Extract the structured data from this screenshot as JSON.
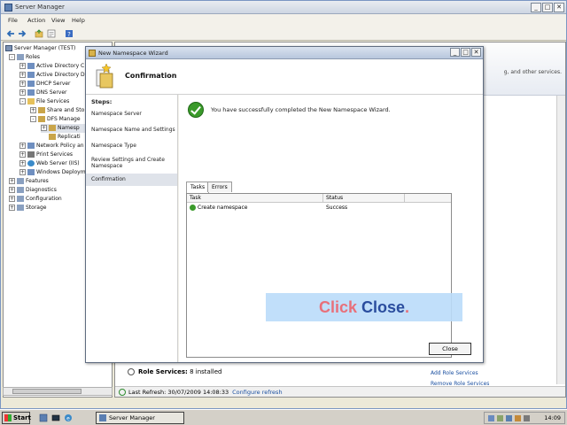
{
  "server_manager": {
    "title": "Server Manager",
    "menu": [
      "File",
      "Action",
      "View",
      "Help"
    ],
    "tree": [
      {
        "label": "Server Manager (TEST)",
        "expander": "",
        "indent": 0
      },
      {
        "label": "Roles",
        "expander": "-",
        "indent": 1
      },
      {
        "label": "Active Directory C",
        "expander": "+",
        "indent": 2
      },
      {
        "label": "Active Directory D",
        "expander": "+",
        "indent": 2
      },
      {
        "label": "DHCP Server",
        "expander": "+",
        "indent": 2
      },
      {
        "label": "DNS Server",
        "expander": "+",
        "indent": 2
      },
      {
        "label": "File Services",
        "expander": "-",
        "indent": 2
      },
      {
        "label": "Share and Sto",
        "expander": "+",
        "indent": 3
      },
      {
        "label": "DFS Manage",
        "expander": "-",
        "indent": 3
      },
      {
        "label": "Namesp",
        "expander": "+",
        "indent": 4
      },
      {
        "label": "Replicati",
        "expander": "",
        "indent": 4
      },
      {
        "label": "Network Policy an",
        "expander": "+",
        "indent": 2
      },
      {
        "label": "Print Services",
        "expander": "+",
        "indent": 2
      },
      {
        "label": "Web Server (IIS)",
        "expander": "+",
        "indent": 2
      },
      {
        "label": "Windows Deploym",
        "expander": "+",
        "indent": 2
      },
      {
        "label": "Features",
        "expander": "+",
        "indent": 1
      },
      {
        "label": "Diagnostics",
        "expander": "+",
        "indent": 1
      },
      {
        "label": "Configuration",
        "expander": "+",
        "indent": 1
      },
      {
        "label": "Storage",
        "expander": "+",
        "indent": 1
      }
    ],
    "header_hint": "g, and other services.",
    "role_services_label": "Role Services:",
    "role_services_count": "8 installed",
    "add_role_services": "Add Role Services",
    "remove_role_services": "Remove Role Services",
    "status_text": "Last Refresh: 30/07/2009 14:08:33",
    "configure_refresh": "Configure refresh"
  },
  "wizard": {
    "title": "New Namespace Wizard",
    "page_title": "Confirmation",
    "steps_title": "Steps:",
    "steps": [
      "Namespace Server",
      "Namespace Name and Settings",
      "Namespace Type",
      "Review Settings and Create Namespace",
      "Confirmation"
    ],
    "active_step": 4,
    "success_message": "You have successfully completed the New Namespace Wizard.",
    "tabs": [
      "Tasks",
      "Errors"
    ],
    "active_tab": 0,
    "table": {
      "columns": [
        "Task",
        "Status"
      ],
      "rows": [
        {
          "task": "Create namespace",
          "status": "Success"
        }
      ]
    },
    "close_label": "Close"
  },
  "callout": {
    "part1": "Click ",
    "part2": "Close",
    "part3": "."
  },
  "taskbar": {
    "start_label": "Start",
    "task_label": "Server Manager",
    "clock": "14:09"
  },
  "colors": {
    "callout_bg": "#badcfa",
    "callout_accent": "#e8707a",
    "callout_keyword": "#2a4d9e",
    "success_green": "#3a9a2a"
  }
}
